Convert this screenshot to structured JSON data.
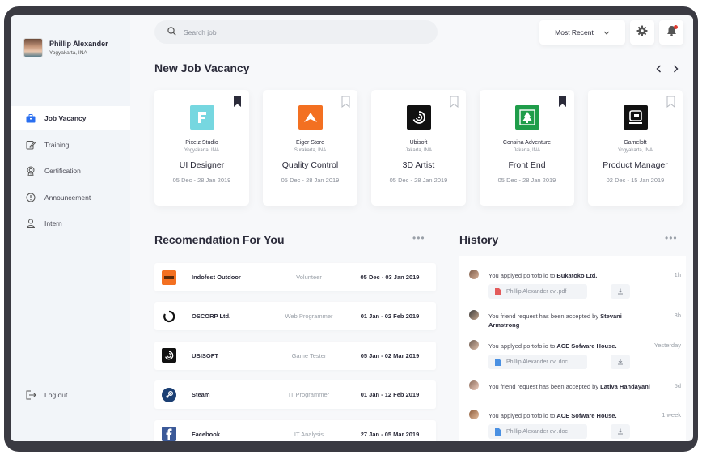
{
  "user": {
    "name": "Phillip Alexander",
    "location": "Yogyakarta, INA"
  },
  "nav": [
    {
      "label": "Job Vacancy",
      "icon": "briefcase-icon",
      "active": true
    },
    {
      "label": "Training",
      "icon": "edit-icon"
    },
    {
      "label": "Certification",
      "icon": "badge-icon"
    },
    {
      "label": "Announcement",
      "icon": "info-icon"
    },
    {
      "label": "Intern",
      "icon": "user-icon"
    }
  ],
  "logout": {
    "label": "Log out"
  },
  "search": {
    "placeholder": "Search job"
  },
  "sort": {
    "label": "Most Recent"
  },
  "vacancy": {
    "title": "New Job Vacancy",
    "cards": [
      {
        "company": "Pixelz Studio",
        "location": "Yogyakarta, INA",
        "role": "UI Designer",
        "dates": "05 Dec  - 28 Jan 2019",
        "bookmarked": true,
        "logo_color": "#76d7e0"
      },
      {
        "company": "Eiger Store",
        "location": "Surakarta, INA",
        "role": "Quality Control",
        "dates": "05 Dec  - 28 Jan 2019",
        "bookmarked": false,
        "logo_color": "#f37021"
      },
      {
        "company": "Ubisoft",
        "location": "Jakarta, INA",
        "role": "3D Artist",
        "dates": "05 Dec  - 28 Jan 2019",
        "bookmarked": false,
        "logo_color": "#111111"
      },
      {
        "company": "Consina Adventure",
        "location": "Jakarta, INA",
        "role": "Front End",
        "dates": "05 Dec  - 28 Jan 2019",
        "bookmarked": true,
        "logo_color": "#1f9d4a"
      },
      {
        "company": "Gameloft",
        "location": "Yogyakarta, INA",
        "role": "Product Manager",
        "dates": "02 Dec  - 15 Jan 2019",
        "bookmarked": false,
        "logo_color": "#111111"
      }
    ]
  },
  "recommendation": {
    "title": "Recomendation For You",
    "rows": [
      {
        "company": "Indofest Outdoor",
        "role": "Volunteer",
        "dates": "05 Dec  - 03 Jan 2019",
        "logo_color": "#f37021"
      },
      {
        "company": "OSCORP Ltd.",
        "role": "Web Programmer",
        "dates": "01 Jan  - 02 Feb 2019",
        "logo_color": "#111111"
      },
      {
        "company": "UBISOFT",
        "role": "Game Tester",
        "dates": "05 Jan  - 02 Mar 2019",
        "logo_color": "#111111"
      },
      {
        "company": "Steam",
        "role": "IT Programmer",
        "dates": "01 Jan  - 12 Feb 2019",
        "logo_color": "#1b3f73"
      },
      {
        "company": "Facebook",
        "role": "IT Analysis",
        "dates": "27 Jan  - 05 Mar 2019",
        "logo_color": "#3b5998"
      }
    ]
  },
  "history": {
    "title": "History",
    "items": [
      {
        "text": "You applyed portofolio to ",
        "bold": "Bukatoko Ltd.",
        "time": "1h",
        "file": "Phillip Alexander cv .pdf",
        "file_color": "#e35b5b"
      },
      {
        "text": "You friend request has been accepted by ",
        "bold": "Stevani Armstrong",
        "time": "3h"
      },
      {
        "text": "You applyed portofolio to ",
        "bold": "ACE Sofware House.",
        "time": "Yesterday",
        "file": "Phillip Alexander cv .doc",
        "file_color": "#4a90e2"
      },
      {
        "text": "You friend request has been accepted by ",
        "bold": "Lativa Handayani",
        "time": "5d"
      },
      {
        "text": "You applyed portofolio to ",
        "bold": "ACE Sofware House.",
        "time": "1 week",
        "file": "Phillip Alexander cv .doc",
        "file_color": "#4a90e2"
      }
    ]
  },
  "colors": {
    "accent": "#2a6ff0",
    "notification": "#e03c31"
  }
}
